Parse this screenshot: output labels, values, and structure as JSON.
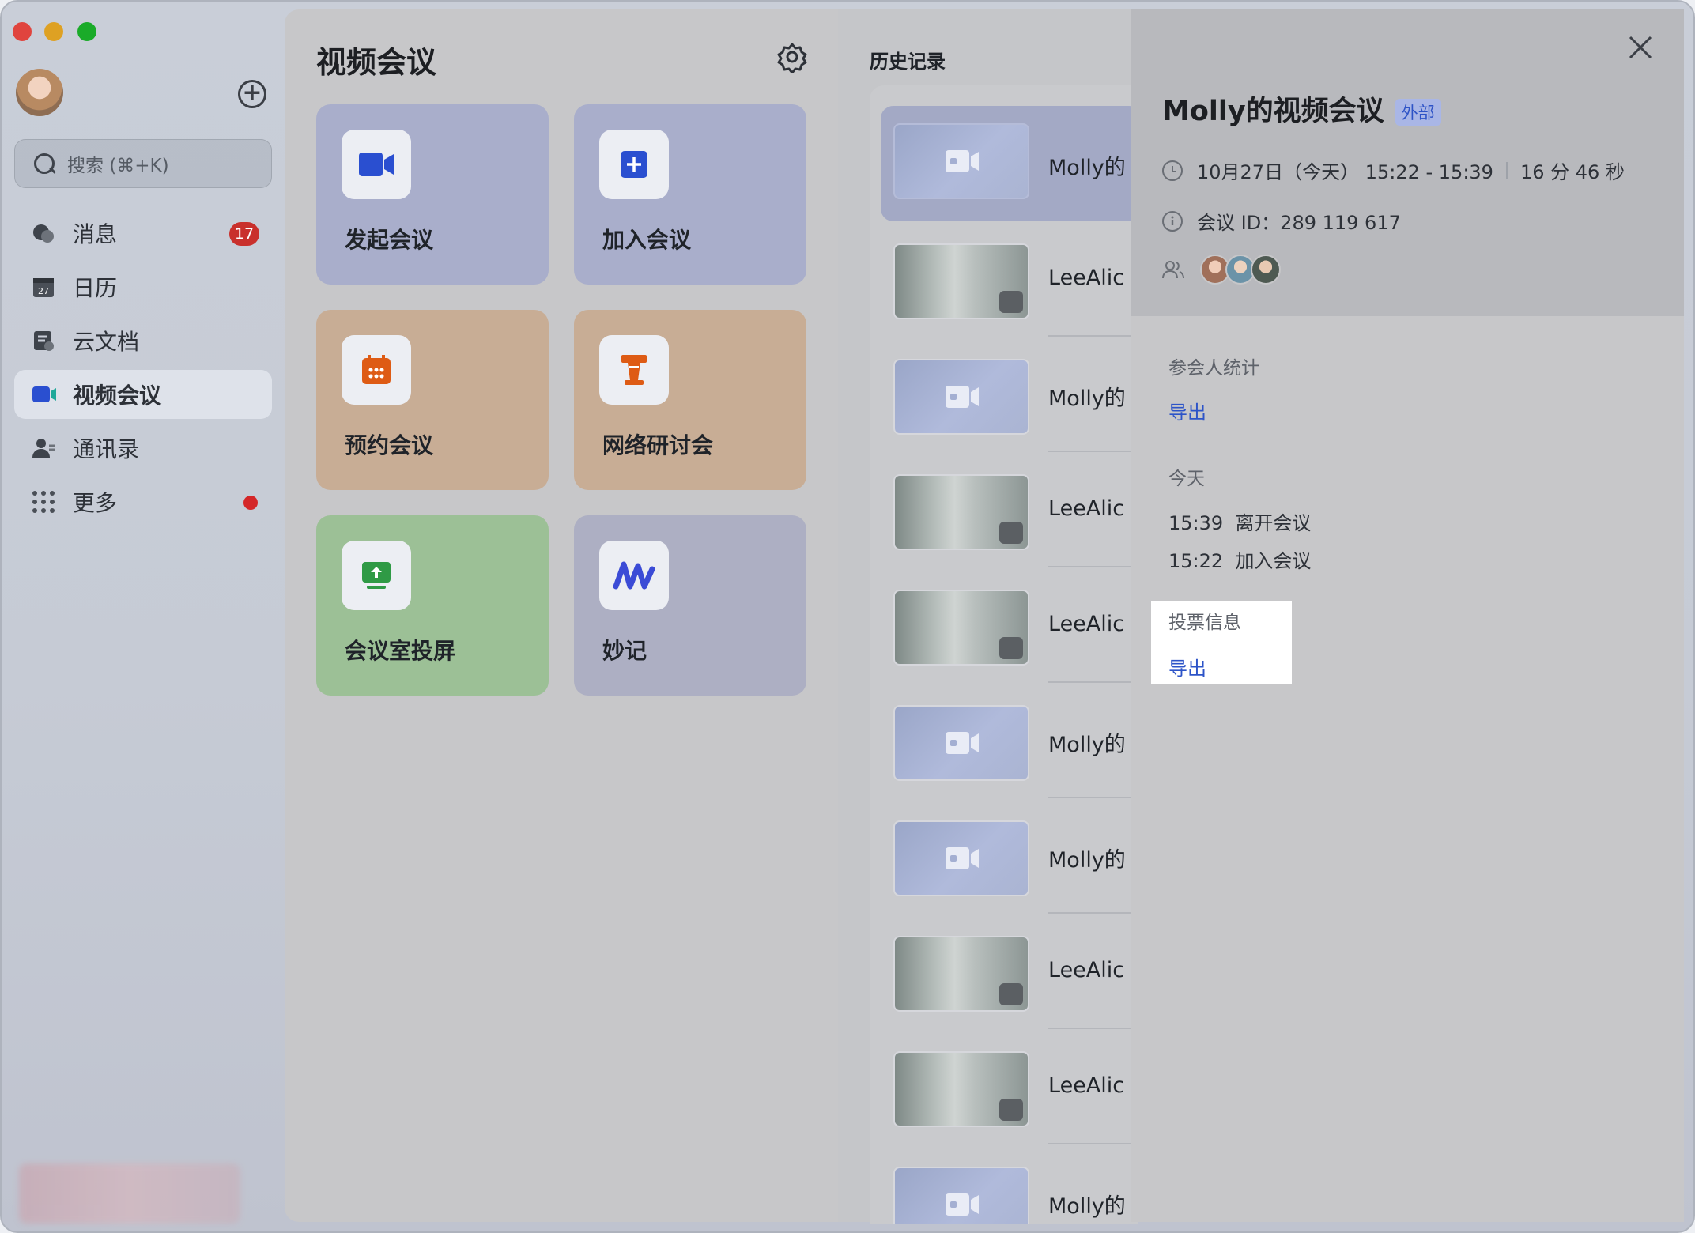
{
  "window": {
    "traffic_lights": [
      "#e0443e",
      "#dea123",
      "#1aab29"
    ]
  },
  "sidebar": {
    "search_placeholder": "搜索 (⌘+K)",
    "items": [
      {
        "label": "消息",
        "icon": "chat-icon",
        "badge": "17"
      },
      {
        "label": "日历",
        "icon": "calendar-icon",
        "day": "27"
      },
      {
        "label": "云文档",
        "icon": "docs-icon"
      },
      {
        "label": "视频会议",
        "icon": "video-icon",
        "active": true
      },
      {
        "label": "通讯录",
        "icon": "contacts-icon"
      },
      {
        "label": "更多",
        "icon": "grid-icon",
        "dot": true
      }
    ]
  },
  "main": {
    "title": "视频会议",
    "cards": [
      {
        "label": "发起会议",
        "icon": "video-camera-icon",
        "color": "#2a4fd0"
      },
      {
        "label": "加入会议",
        "icon": "plus-square-icon",
        "color": "#2a4fd0"
      },
      {
        "label": "预约会议",
        "icon": "calendar-icon",
        "color": "#de5b14"
      },
      {
        "label": "网络研讨会",
        "icon": "podium-icon",
        "color": "#de5b14"
      },
      {
        "label": "会议室投屏",
        "icon": "screen-share-icon",
        "color": "#2f9a45"
      },
      {
        "label": "妙记",
        "icon": "minutes-icon",
        "color": "#3b4bd6"
      }
    ]
  },
  "history": {
    "title": "历史记录",
    "items": [
      {
        "name": "Molly的",
        "type": "vid"
      },
      {
        "name": "LeeAlic",
        "type": "blur"
      },
      {
        "name": "Molly的",
        "type": "vid"
      },
      {
        "name": "LeeAlic",
        "type": "blur"
      },
      {
        "name": "LeeAlic",
        "type": "blur"
      },
      {
        "name": "Molly的",
        "type": "vid"
      },
      {
        "name": "Molly的",
        "type": "vid"
      },
      {
        "name": "LeeAlic",
        "type": "blur"
      },
      {
        "name": "LeeAlic",
        "type": "blur"
      },
      {
        "name": "Molly的",
        "type": "vid"
      }
    ]
  },
  "detail": {
    "title": "Molly的视频会议",
    "tag": "外部",
    "date": "10月27日（今天） 15:22 - 15:39",
    "duration": "16 分 46 秒",
    "meeting_id": "会议 ID：289 119 617",
    "participants_stats_heading": "参会人统计",
    "export_label": "导出",
    "today_heading": "今天",
    "events": [
      {
        "time": "15:39",
        "text": "离开会议"
      },
      {
        "time": "15:22",
        "text": "加入会议"
      }
    ],
    "vote_heading": "投票信息",
    "vote_export_label": "导出"
  }
}
